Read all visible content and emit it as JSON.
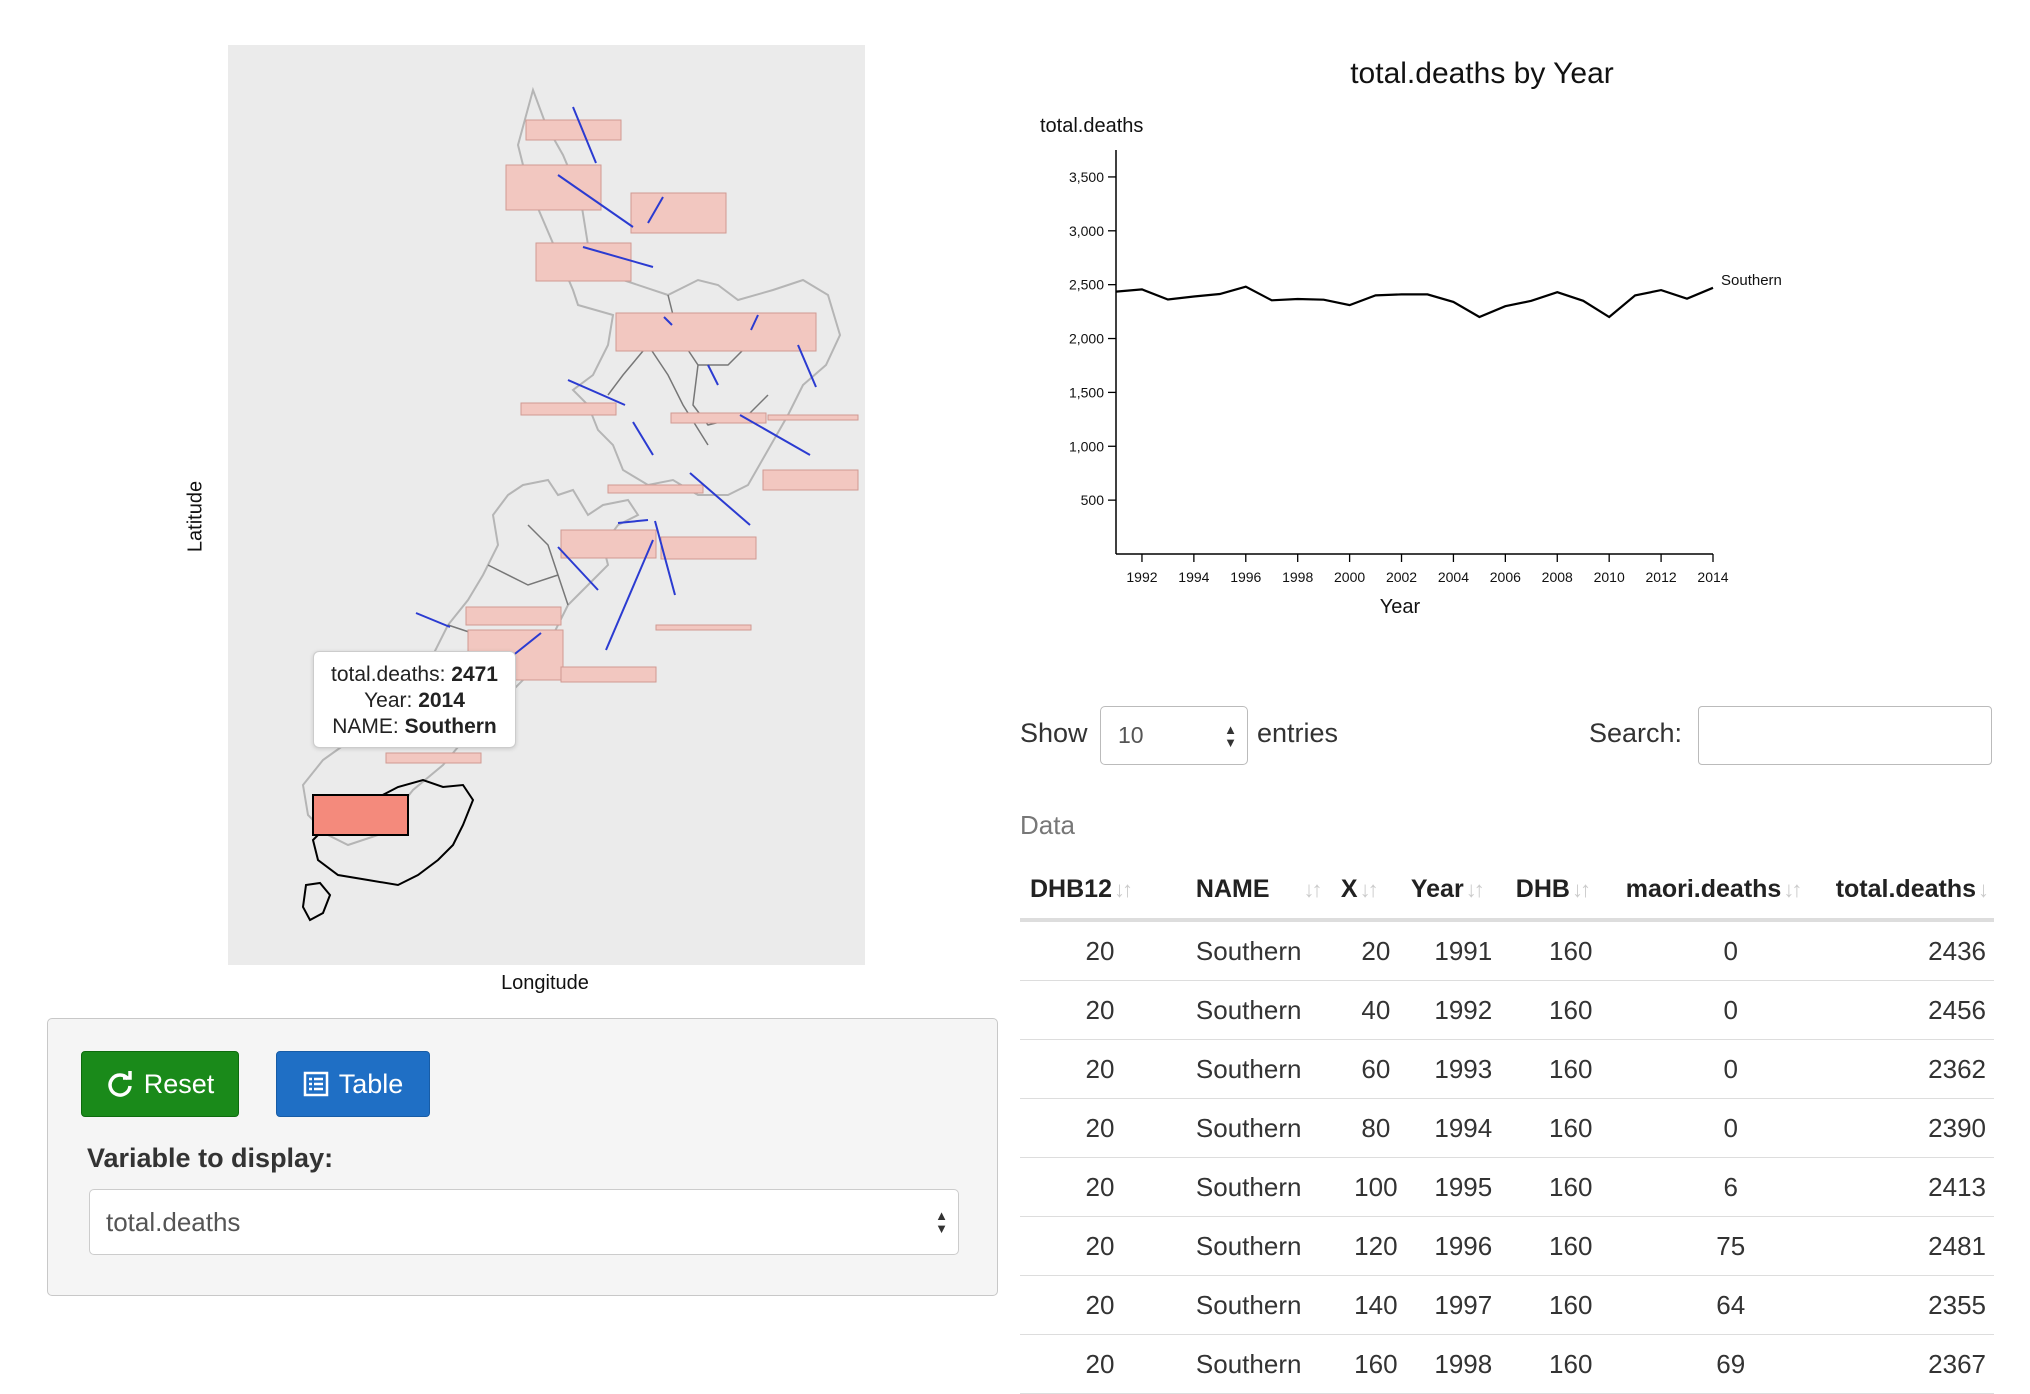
{
  "map": {
    "y_axis_label": "Latitude",
    "x_axis_label": "Longitude",
    "tooltip": {
      "variable_label": "total.deaths:",
      "variable_value": "2471",
      "year_label": "Year:",
      "year_value": "2014",
      "name_label": "NAME:",
      "name_value": "Southern"
    },
    "colors": {
      "panel_bg": "#ebebeb",
      "highlight_fill": "#f48a7c",
      "bar_fill": "#f2c7c0",
      "glyph_line": "#2b3bd1"
    }
  },
  "controls": {
    "reset_label": "Reset",
    "table_label": "Table",
    "variable_label": "Variable to display:",
    "variable_value": "total.deaths"
  },
  "chart_data": {
    "type": "line",
    "title": "total.deaths by Year",
    "xlabel": "Year",
    "ylabel": "total.deaths",
    "xlim": [
      1991,
      2014
    ],
    "ylim": [
      0,
      3750
    ],
    "x_ticks": [
      1992,
      1994,
      1996,
      1998,
      2000,
      2002,
      2004,
      2006,
      2008,
      2010,
      2012,
      2014
    ],
    "y_ticks": [
      500,
      1000,
      1500,
      2000,
      2500,
      3000,
      3500
    ],
    "series": [
      {
        "name": "Southern",
        "x": [
          1991,
          1992,
          1993,
          1994,
          1995,
          1996,
          1997,
          1998,
          1999,
          2000,
          2001,
          2002,
          2003,
          2004,
          2005,
          2006,
          2007,
          2008,
          2009,
          2010,
          2011,
          2012,
          2013,
          2014
        ],
        "values": [
          2436,
          2456,
          2362,
          2390,
          2413,
          2481,
          2355,
          2367,
          2360,
          2310,
          2400,
          2410,
          2410,
          2340,
          2200,
          2300,
          2350,
          2430,
          2350,
          2200,
          2400,
          2450,
          2370,
          2471
        ]
      }
    ]
  },
  "datatable": {
    "show_label": "Show",
    "length_value": "10",
    "entries_label": "entries",
    "search_label": "Search:",
    "search_value": "",
    "caption": "Data",
    "columns": [
      "DHB12",
      "NAME",
      "X",
      "Year",
      "DHB",
      "maori.deaths",
      "total.deaths"
    ],
    "rows": [
      [
        "20",
        "Southern",
        "20",
        "1991",
        "160",
        "0",
        "2436"
      ],
      [
        "20",
        "Southern",
        "40",
        "1992",
        "160",
        "0",
        "2456"
      ],
      [
        "20",
        "Southern",
        "60",
        "1993",
        "160",
        "0",
        "2362"
      ],
      [
        "20",
        "Southern",
        "80",
        "1994",
        "160",
        "0",
        "2390"
      ],
      [
        "20",
        "Southern",
        "100",
        "1995",
        "160",
        "6",
        "2413"
      ],
      [
        "20",
        "Southern",
        "120",
        "1996",
        "160",
        "75",
        "2481"
      ],
      [
        "20",
        "Southern",
        "140",
        "1997",
        "160",
        "64",
        "2355"
      ],
      [
        "20",
        "Southern",
        "160",
        "1998",
        "160",
        "69",
        "2367"
      ]
    ]
  }
}
